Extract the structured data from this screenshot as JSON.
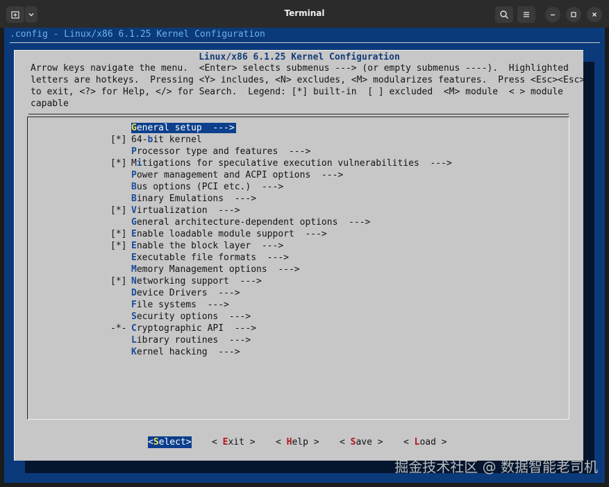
{
  "window": {
    "title": "Terminal"
  },
  "terminal": {
    "config_line": ".config - Linux/x86 6.1.25 Kernel Configuration",
    "dialog_title": "Linux/x86 6.1.25 Kernel Configuration",
    "help_lines": [
      "Arrow keys navigate the menu.  <Enter> selects submenus ---> (or empty submenus ----).  Highlighted",
      "letters are hotkeys.  Pressing <Y> includes, <N> excludes, <M> modularizes features.  Press <Esc><Esc>",
      "to exit, <?> for Help, </> for Search.  Legend: [*] built-in  [ ] excluded  <M> module  < > module",
      "capable"
    ],
    "menu_items": [
      {
        "prefix": "",
        "hotkey": "G",
        "rest": "eneral setup  --->",
        "selected": true
      },
      {
        "prefix": "[*]",
        "pre": "64-",
        "hotkey": "b",
        "rest": "it kernel"
      },
      {
        "prefix": "",
        "hotkey": "P",
        "rest": "rocessor type and features  --->"
      },
      {
        "prefix": "[*]",
        "pre": "M",
        "hotkey": "i",
        "rest": "tigations for speculative execution vulnerabilities  --->"
      },
      {
        "prefix": "",
        "hotkey": "P",
        "rest": "ower management and ACPI options  --->"
      },
      {
        "prefix": "",
        "hotkey": "B",
        "rest": "us options (PCI etc.)  --->"
      },
      {
        "prefix": "",
        "hotkey": "B",
        "rest": "inary Emulations  --->"
      },
      {
        "prefix": "[*]",
        "hotkey": "V",
        "rest": "irtualization  --->"
      },
      {
        "prefix": "",
        "hotkey": "G",
        "rest": "eneral architecture-dependent options  --->"
      },
      {
        "prefix": "[*]",
        "hotkey": "E",
        "rest": "nable loadable module support  --->"
      },
      {
        "prefix": "[*]",
        "hotkey": "E",
        "rest": "nable the block layer  --->"
      },
      {
        "prefix": "",
        "hotkey": "E",
        "rest": "xecutable file formats  --->"
      },
      {
        "prefix": "",
        "hotkey": "M",
        "rest": "emory Management options  --->"
      },
      {
        "prefix": "[*]",
        "hotkey": "N",
        "rest": "etworking support  --->"
      },
      {
        "prefix": "",
        "hotkey": "D",
        "rest": "evice Drivers  --->"
      },
      {
        "prefix": "",
        "hotkey": "F",
        "rest": "ile systems  --->"
      },
      {
        "prefix": "",
        "hotkey": "S",
        "rest": "ecurity options  --->"
      },
      {
        "prefix": "-*-",
        "hotkey": "C",
        "rest": "ryptographic API  --->"
      },
      {
        "prefix": "",
        "hotkey": "L",
        "rest": "ibrary routines  --->"
      },
      {
        "prefix": "",
        "hotkey": "K",
        "rest": "ernel hacking  --->"
      }
    ],
    "buttons": [
      {
        "left": "<",
        "hotkey": "S",
        "rest": "elect",
        "right": ">",
        "active": true
      },
      {
        "left": "< ",
        "hotkey": "E",
        "rest": "xit",
        "right": " >"
      },
      {
        "left": "< ",
        "hotkey": "H",
        "rest": "elp",
        "right": " >"
      },
      {
        "left": "< ",
        "hotkey": "S",
        "rest": "ave",
        "right": " >"
      },
      {
        "left": "< ",
        "hotkey": "L",
        "rest": "oad",
        "right": " >"
      }
    ]
  },
  "watermark": "掘金技术社区 @ 数据智能老司机",
  "icons": {
    "new_tab": "new-tab-icon",
    "dropdown": "chevron-down-icon",
    "search": "search-icon",
    "menu": "hamburger-menu-icon",
    "minimize": "minimize-icon",
    "maximize": "maximize-icon",
    "close": "close-icon"
  },
  "colors": {
    "terminal_bg": "#0a3a7a",
    "dialog_bg": "#c7c7c7",
    "selection_bg": "#0c3f8c",
    "hotkey_selected": "#f4e04d",
    "button_hotkey": "#b0161c"
  }
}
